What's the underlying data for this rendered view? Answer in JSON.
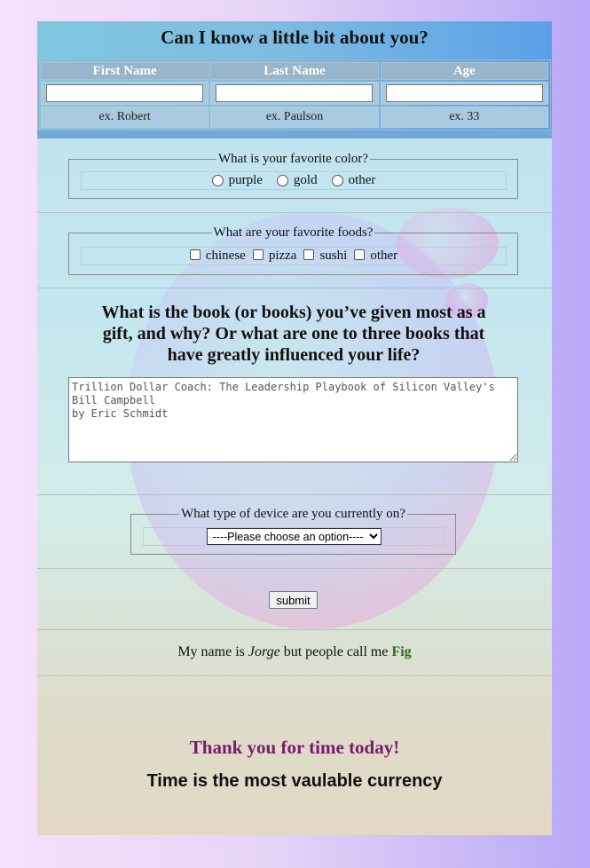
{
  "header": {
    "title": "Can I know a little bit about you?",
    "columns": [
      "First Name",
      "Last Name",
      "Age"
    ],
    "examples": [
      "ex. Robert",
      "ex. Paulson",
      "ex. 33"
    ]
  },
  "color_question": {
    "legend": "What is your favorite color?",
    "options": [
      "purple",
      "gold",
      "other"
    ]
  },
  "food_question": {
    "legend": "What are your favorite foods?",
    "options": [
      "chinese",
      "pizza",
      "sushi",
      "other"
    ]
  },
  "book_question": {
    "text": "What is the book (or books) you’ve given most as a gift, and why? Or what are one to three books that have greatly influenced your life?",
    "answer": "Trillion Dollar Coach: The Leadership Playbook of Silicon Valley's\nBill Campbell\nby Eric Schmidt"
  },
  "device_question": {
    "legend": "What type of device are you currently on?",
    "selected": "----Please choose an option----"
  },
  "submit_label": "submit",
  "intro": {
    "before": "My name is ",
    "name": "Jorge",
    "middle": " but people call me ",
    "nickname": "Fig"
  },
  "closing": {
    "thanks": "Thank you for time today!",
    "tagline": "Time is the most vaulable currency"
  }
}
